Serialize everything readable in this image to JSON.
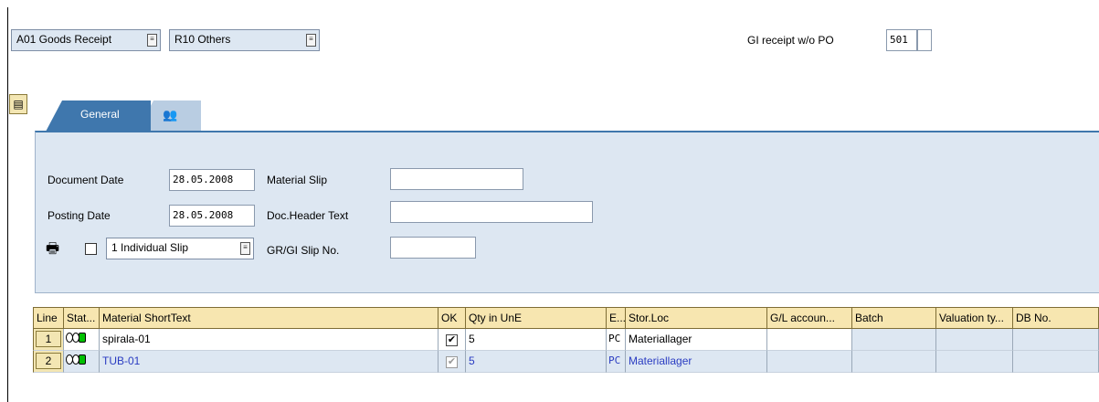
{
  "header": {
    "transaction_dropdown": "A01 Goods Receipt",
    "reference_dropdown": "R10 Others",
    "movement_label": "GI receipt w/o PO",
    "movement_value": "501"
  },
  "tabs": [
    {
      "label": "General"
    },
    {
      "label": ""
    }
  ],
  "general": {
    "document_date_label": "Document Date",
    "document_date_value": "28.05.2008",
    "posting_date_label": "Posting Date",
    "posting_date_value": "28.05.2008",
    "material_slip_label": "Material Slip",
    "material_slip_value": "",
    "doc_header_text_label": "Doc.Header Text",
    "doc_header_text_value": "",
    "slip_dropdown": "1 Individual Slip",
    "slip_no_label": "GR/GI Slip No.",
    "slip_no_value": ""
  },
  "table": {
    "columns": [
      "Line",
      "Stat...",
      "Material ShortText",
      "OK",
      "Qty in UnE",
      "E...",
      "Stor.Loc",
      "G/L accoun...",
      "Batch",
      "Valuation ty...",
      "DB No."
    ],
    "rows": [
      {
        "line": "1",
        "material": "spirala-01",
        "ok": "✔",
        "qty": "5",
        "unit": "PC",
        "stor_loc": "Materiallager"
      },
      {
        "line": "2",
        "material": "TUB-01",
        "ok": "✔",
        "qty": "5",
        "unit": "PC",
        "stor_loc": "Materiallager"
      }
    ]
  },
  "colors": {
    "panel_bg": "#dde7f2",
    "tab_active": "#3f77ad",
    "header_bg": "#f7e6b0",
    "link_blue": "#2a3cc2",
    "status_green": "#00c000"
  }
}
